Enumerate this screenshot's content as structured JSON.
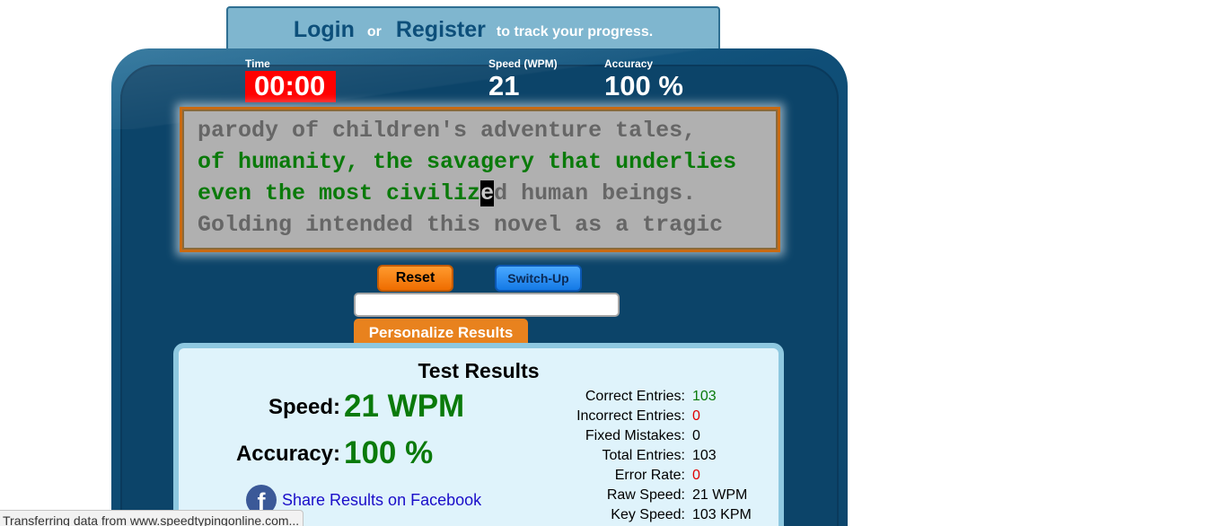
{
  "banner": {
    "login": "Login",
    "or": "or",
    "register": "Register",
    "tail": "to track your progress."
  },
  "stats": {
    "time_label": "Time",
    "time_value": "00:00",
    "speed_label": "Speed (WPM)",
    "speed_value": "21",
    "accuracy_label": "Accuracy",
    "accuracy_value": "100 %"
  },
  "text_lines": {
    "line1": "parody of children's adventure tales,",
    "line2": "of humanity, the savagery that underlies",
    "line3_done": "even the most civiliz",
    "line3_cursor": "e",
    "line3_rest": "d human beings.",
    "line4": "Golding intended this novel as a tragic"
  },
  "controls": {
    "reset": "Reset",
    "switch_up": "Switch-Up",
    "personalize": "Personalize Results"
  },
  "results": {
    "title": "Test Results",
    "speed_label": "Speed:",
    "speed_value": "21 WPM",
    "accuracy_label": "Accuracy:",
    "accuracy_value": "100 %",
    "share": "Share Results on Facebook",
    "facebook_glyph": "f",
    "details": [
      {
        "label": "Correct Entries:",
        "value": "103",
        "tone": "green"
      },
      {
        "label": "Incorrect Entries:",
        "value": "0",
        "tone": "red"
      },
      {
        "label": "Fixed Mistakes:",
        "value": "0",
        "tone": "black"
      },
      {
        "label": "Total Entries:",
        "value": "103",
        "tone": "black"
      },
      {
        "label": "Error Rate:",
        "value": "0",
        "tone": "red"
      },
      {
        "label": "Raw Speed:",
        "value": "21 WPM",
        "tone": "black"
      },
      {
        "label": "Key Speed:",
        "value": "103 KPM",
        "tone": "black"
      }
    ]
  },
  "status_bar": "Transferring data from www.speedtypingonline.com...",
  "colors": {
    "panel": "#0c4469",
    "timer_bg": "#ff0000",
    "correct_text": "#0a7a0a",
    "pending_text": "#666666"
  }
}
